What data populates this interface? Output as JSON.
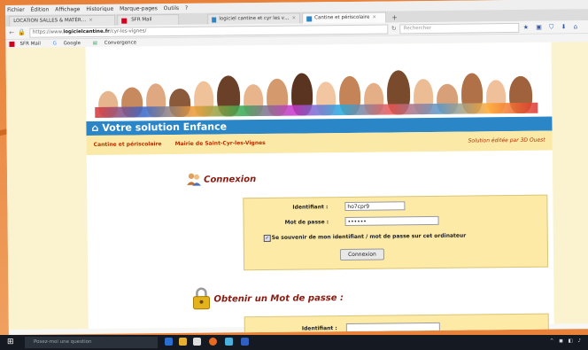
{
  "browser": {
    "menu": [
      "Fichier",
      "Édition",
      "Affichage",
      "Historique",
      "Marque-pages",
      "Outils",
      "?"
    ],
    "tabs": [
      {
        "label": "LOCATION SALLES & MATÉR…",
        "active": false
      },
      {
        "label": "SFR Mail",
        "active": false
      },
      {
        "label": "logiciel cantine et cyr les v…",
        "active": false
      },
      {
        "label": "Cantine et périscolaire",
        "active": true
      }
    ],
    "url_prefix": "https://www.",
    "url_domain": "logicielcantine.fr",
    "url_path": "/cyr-les-vignes/",
    "search_placeholder": "Rechercher",
    "bookmarks": [
      "SFR Mail",
      "Google",
      "Convergence"
    ]
  },
  "page": {
    "title": "Votre solution Enfance",
    "nav_left": "Cantine et périscolaire",
    "nav_middle": "Mairie de Saint-Cyr-les-Vignes",
    "nav_right": "Solution éditée par 3D Ouest",
    "login": {
      "heading": "Connexion",
      "id_label": "Identifiant :",
      "id_value": "ho7cpr9",
      "pw_label": "Mot de passe :",
      "pw_value": "••••••",
      "remember_label": "Se souvenir de mon identifiant / mot de passe sur cet ordinateur",
      "remember_checked": true,
      "button": "Connexion"
    },
    "password": {
      "heading": "Obtenir un Mot de passe :",
      "id_label": "Identifiant :",
      "id_value": ""
    }
  },
  "taskbar": {
    "search_placeholder": "Posez-moi une question"
  },
  "colors": {
    "orange_frame": "#e8823a",
    "title_blue": "#2a86c6",
    "nav_yellow": "#fbe9a8",
    "form_yellow": "#fdeaa6",
    "heading_red": "#8b1a10"
  }
}
